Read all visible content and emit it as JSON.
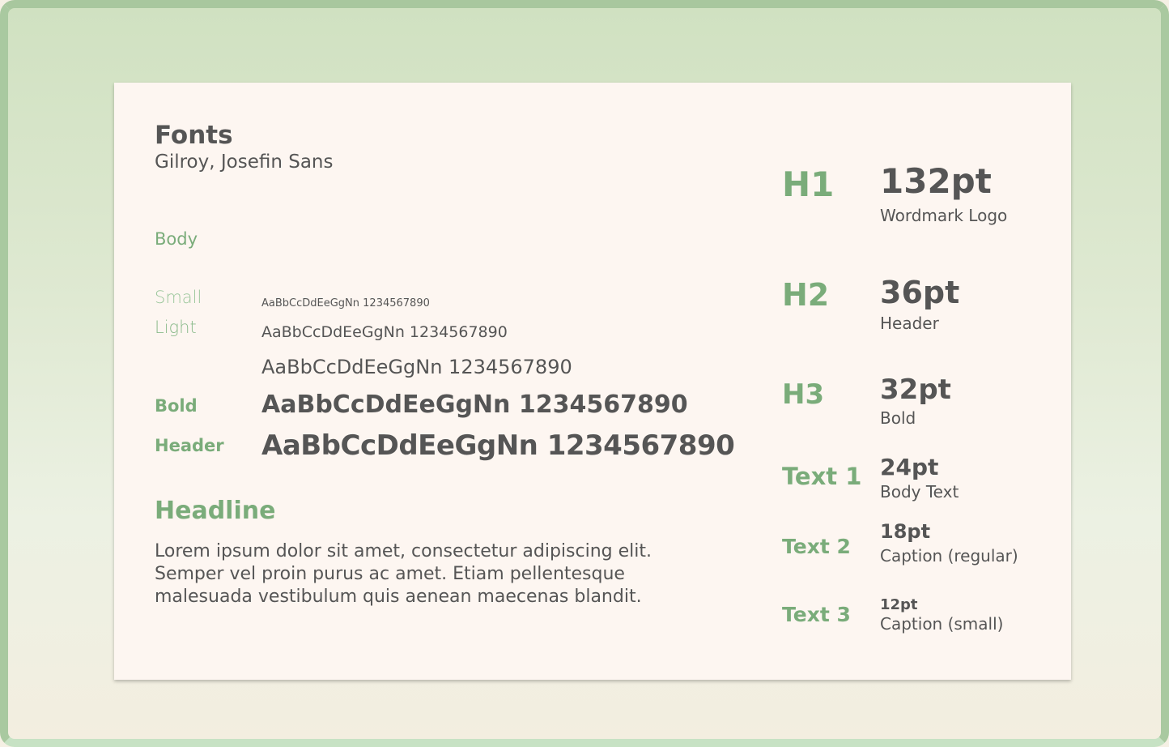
{
  "title": "Fonts",
  "subtitle": "Gilroy, Josefin Sans",
  "body_section": {
    "label": "Body",
    "weights": {
      "small": "Small",
      "light": "Light",
      "bold": "Bold",
      "header": "Header"
    },
    "samples": {
      "small": "AaBbCcDdEeGgNn 1234567890",
      "light": "AaBbCcDdEeGgNn 1234567890",
      "regular": "AaBbCcDdEeGgNn 1234567890",
      "bold": "AaBbCcDdEeGgNn 1234567890",
      "header": "AaBbCcDdEeGgNn 1234567890"
    }
  },
  "headline": {
    "label": "Headline",
    "text": "Lorem ipsum dolor sit amet, consectetur adipiscing elit. Semper vel proin purus ac amet. Etiam pellentesque malesuada vestibulum quis aenean maecenas blandit."
  },
  "type_scale": [
    {
      "label": "H1",
      "size": "132pt",
      "description": "Wordmark Logo"
    },
    {
      "label": "H2",
      "size": "36pt",
      "description": "Header"
    },
    {
      "label": "H3",
      "size": "32pt",
      "description": "Bold"
    },
    {
      "label": "Text 1",
      "size": "24pt",
      "description": "Body Text"
    },
    {
      "label": "Text 2",
      "size": "18pt",
      "description": "Caption (regular)"
    },
    {
      "label": "Text 3",
      "size": "12pt",
      "description": "Caption (small)"
    }
  ],
  "colors": {
    "accent_green": "#7aac7a",
    "text_gray": "#555555",
    "card_background": "#fdf6f1",
    "frame_border": "#a9c9a0"
  }
}
